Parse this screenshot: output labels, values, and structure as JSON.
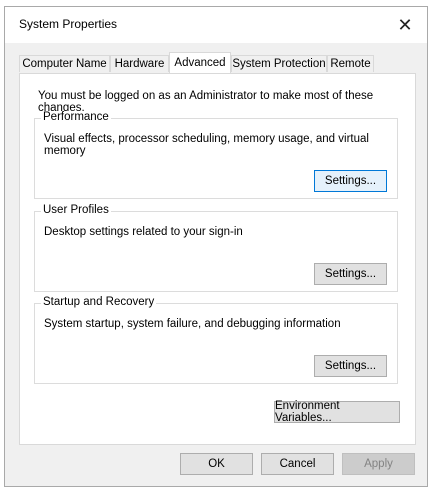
{
  "window": {
    "title": "System Properties",
    "close_icon": "close-icon"
  },
  "tabs": [
    {
      "label": "Computer Name",
      "active": false
    },
    {
      "label": "Hardware",
      "active": false
    },
    {
      "label": "Advanced",
      "active": true
    },
    {
      "label": "System Protection",
      "active": false
    },
    {
      "label": "Remote",
      "active": false
    }
  ],
  "advanced": {
    "intro": "You must be logged on as an Administrator to make most of these changes.",
    "performance": {
      "legend": "Performance",
      "description": "Visual effects, processor scheduling, memory usage, and virtual memory",
      "button": "Settings..."
    },
    "user_profiles": {
      "legend": "User Profiles",
      "description": "Desktop settings related to your sign-in",
      "button": "Settings..."
    },
    "startup_recovery": {
      "legend": "Startup and Recovery",
      "description": "System startup, system failure, and debugging information",
      "button": "Settings..."
    },
    "env_button": "Environment Variables..."
  },
  "footer": {
    "ok": "OK",
    "cancel": "Cancel",
    "apply": "Apply"
  }
}
